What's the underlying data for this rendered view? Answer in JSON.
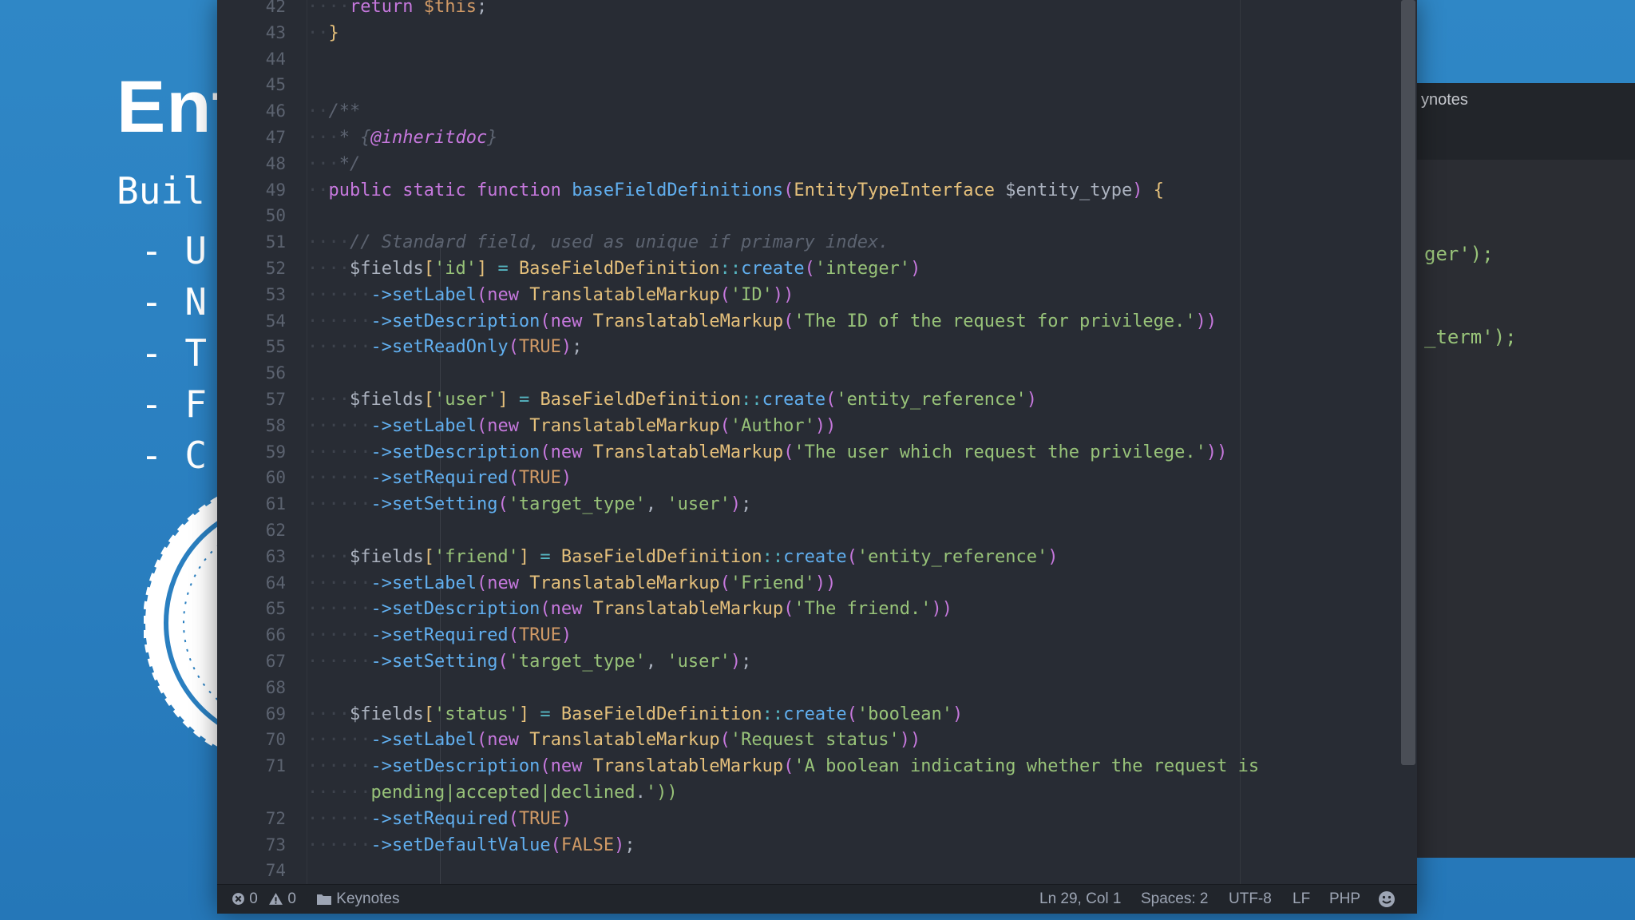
{
  "slide": {
    "title": "Ent",
    "subtitle": "Buil",
    "bullets": [
      "- U",
      "- N",
      "- T",
      "- F",
      "- C"
    ]
  },
  "background_editor": {
    "tab_label": "ynotes",
    "code_fragments": [
      "ger');",
      "_term');"
    ]
  },
  "editor": {
    "line_numbers": [
      "42",
      "43",
      "44",
      "45",
      "46",
      "47",
      "48",
      "49",
      "50",
      "51",
      "52",
      "53",
      "54",
      "55",
      "56",
      "57",
      "58",
      "59",
      "60",
      "61",
      "62",
      "63",
      "64",
      "65",
      "66",
      "67",
      "68",
      "69",
      "70",
      "71",
      "",
      "72",
      "73",
      "74"
    ],
    "code_lines": [
      "    return $this;",
      "  }",
      "",
      "",
      "  /**",
      "   * {@inheritdoc}",
      "   */",
      "  public static function baseFieldDefinitions(EntityTypeInterface $entity_type) {",
      "",
      "    // Standard field, used as unique if primary index.",
      "    $fields['id'] = BaseFieldDefinition::create('integer')",
      "      ->setLabel(new TranslatableMarkup('ID'))",
      "      ->setDescription(new TranslatableMarkup('The ID of the request for privilege.'))",
      "      ->setReadOnly(TRUE);",
      "",
      "    $fields['user'] = BaseFieldDefinition::create('entity_reference')",
      "      ->setLabel(new TranslatableMarkup('Author'))",
      "      ->setDescription(new TranslatableMarkup('The user which request the privilege.'))",
      "      ->setRequired(TRUE)",
      "      ->setSetting('target_type', 'user');",
      "",
      "    $fields['friend'] = BaseFieldDefinition::create('entity_reference')",
      "      ->setLabel(new TranslatableMarkup('Friend'))",
      "      ->setDescription(new TranslatableMarkup('The friend.'))",
      "      ->setRequired(TRUE)",
      "      ->setSetting('target_type', 'user');",
      "",
      "    $fields['status'] = BaseFieldDefinition::create('boolean')",
      "      ->setLabel(new TranslatableMarkup('Request status'))",
      "      ->setDescription(new TranslatableMarkup('A boolean indicating whether the request is",
      "      pending|accepted|declined.'))",
      "      ->setRequired(TRUE)",
      "      ->setDefaultValue(FALSE);",
      ""
    ]
  },
  "statusbar": {
    "errors": "0",
    "warnings": "0",
    "project": "Keynotes",
    "cursor": "Ln 29, Col 1",
    "indent": "Spaces: 2",
    "encoding": "UTF-8",
    "line_ending": "LF",
    "grammar": "PHP",
    "feedback_icon": "smiley-icon"
  },
  "colors": {
    "slide_background": "#2a7fc0",
    "editor_background": "#282c34",
    "keyword": "#c678dd",
    "function": "#61afef",
    "string": "#98c379",
    "class": "#e5c07b",
    "constant": "#d19a66",
    "comment": "#5c6370"
  }
}
